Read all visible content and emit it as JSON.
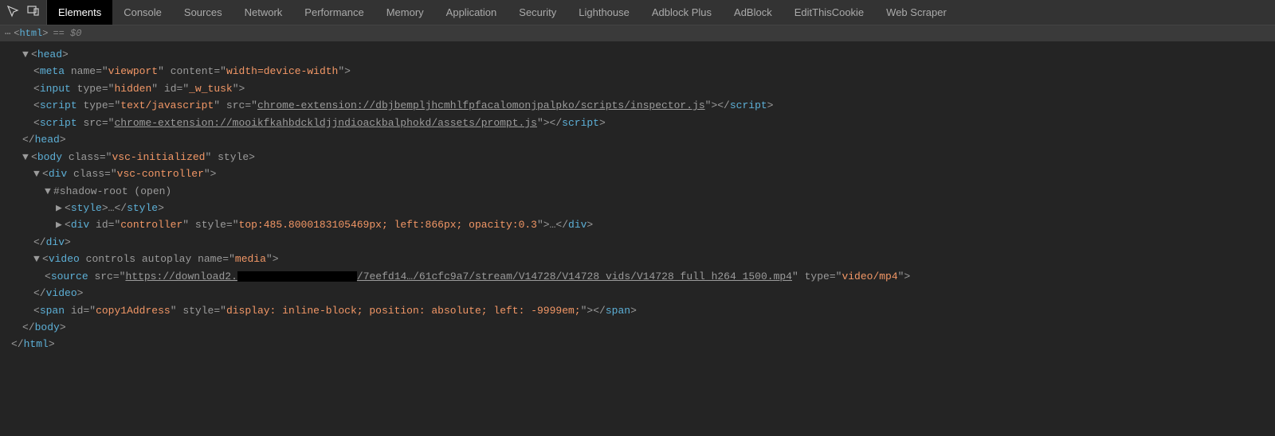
{
  "tabs": [
    "Elements",
    "Console",
    "Sources",
    "Network",
    "Performance",
    "Memory",
    "Application",
    "Security",
    "Lighthouse",
    "Adblock Plus",
    "AdBlock",
    "EditThisCookie",
    "Web Scraper"
  ],
  "activeTab": "Elements",
  "breadcrumb": {
    "dots": "⋯",
    "tag": "html",
    "selected": "== $0"
  },
  "dom": {
    "html_open": "<html>",
    "head_open": "<head>",
    "meta": {
      "name": "viewport",
      "content": "width=device-width"
    },
    "input": {
      "type": "hidden",
      "id": "_w_tusk"
    },
    "script1": {
      "type": "text/javascript",
      "src": "chrome-extension://dbjbempljhcmhlfpfacalomonjpalpko/scripts/inspector.js"
    },
    "script2": {
      "src": "chrome-extension://mooikfkahbdckldjjndioackbalphokd/assets/prompt.js"
    },
    "head_close": "</head>",
    "body_open": {
      "class": "vsc-initialized",
      "style": ""
    },
    "div_vsc": {
      "class": "vsc-controller"
    },
    "shadow": "#shadow-root (open)",
    "style_node": "<style>…</style>",
    "controller": {
      "id": "controller",
      "style": "top:485.8000183105469px; left:866px; opacity:0.3"
    },
    "div_close": "</div>",
    "video": {
      "attrs": "controls autoplay",
      "name": "media"
    },
    "source": {
      "url_a": "https://download2.",
      "url_b": "/7eefd14…/61cfc9a7/stream/V14728/V14728_vids/V14728_full_h264_1500.mp4",
      "type": "video/mp4"
    },
    "video_close": "</video>",
    "span": {
      "id": "copy1Address",
      "style": "display: inline-block; position: absolute; left: -9999em;"
    },
    "body_close": "</body>",
    "html_close": "</html>"
  }
}
